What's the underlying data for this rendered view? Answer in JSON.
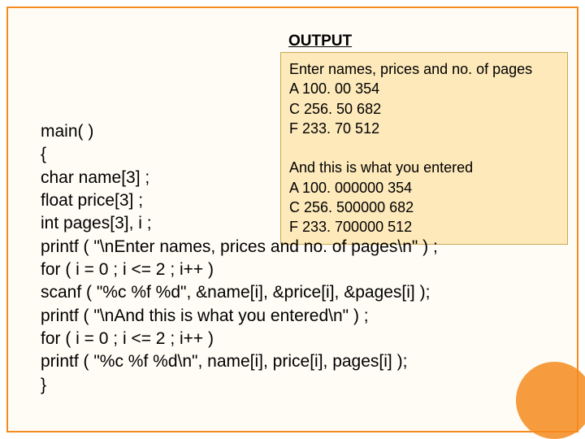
{
  "output": {
    "label": "OUTPUT",
    "text": "Enter names, prices and no. of pages\nA 100. 00 354\nC 256. 50 682\nF 233. 70 512\n\nAnd this is what you entered\nA 100. 000000 354\nC 256. 500000 682\nF 233. 700000 512"
  },
  "code": "main( )\n{\nchar name[3] ;\nfloat price[3] ;\nint pages[3], i ;\nprintf ( \"\\nEnter names, prices and no. of pages\\n\" ) ;\nfor ( i = 0 ; i <= 2 ; i++ )\nscanf ( \"%c %f %d\", &name[i], &price[i], &pages[i] );\nprintf ( \"\\nAnd this is what you entered\\n\" ) ;\nfor ( i = 0 ; i <= 2 ; i++ )\nprintf ( \"%c %f %d\\n\", name[i], price[i], pages[i] );\n}"
}
